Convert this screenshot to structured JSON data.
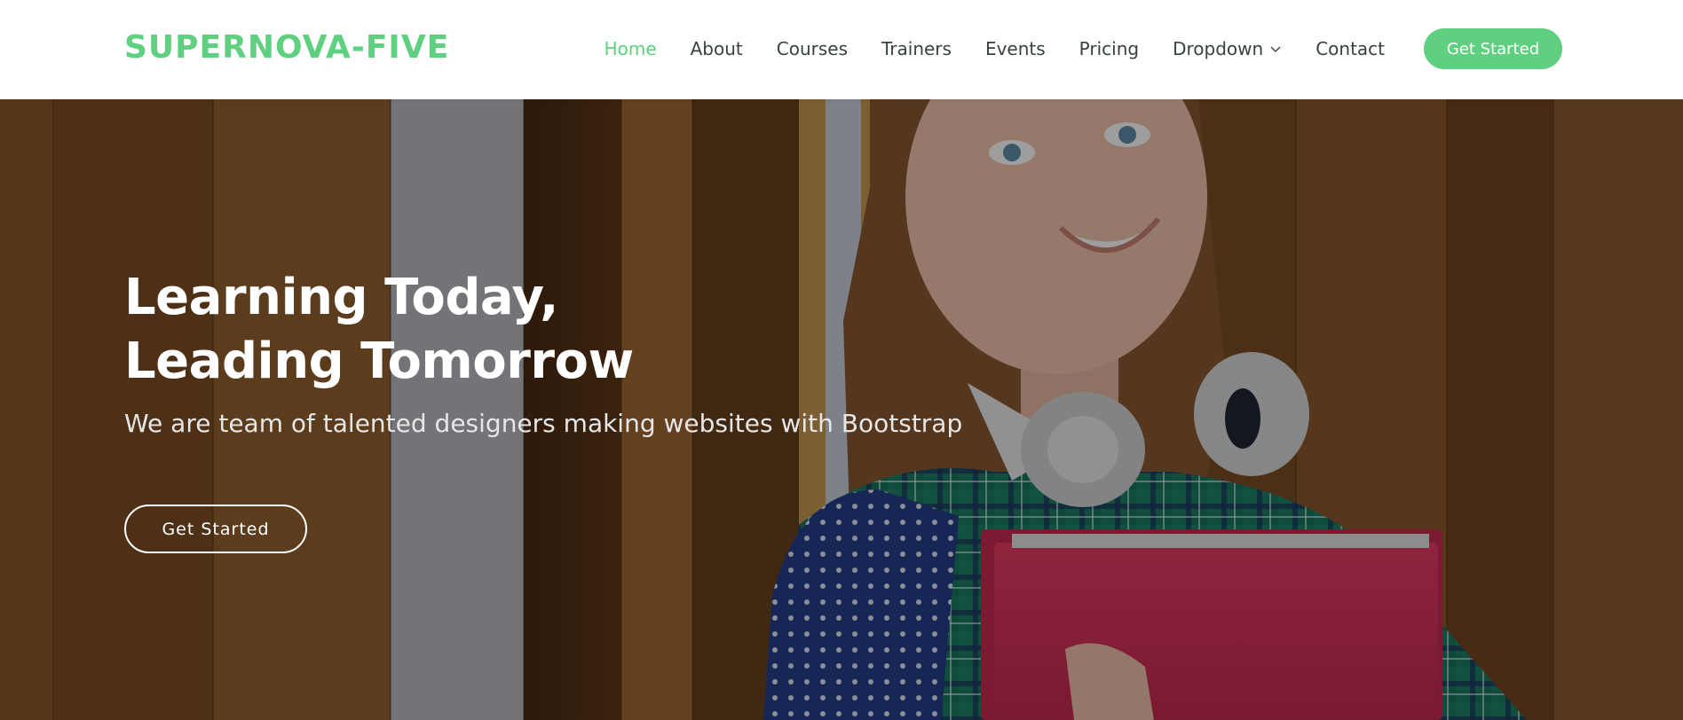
{
  "header": {
    "logo": "SUPERNOVA-FIVE",
    "nav": [
      {
        "label": "Home",
        "active": true
      },
      {
        "label": "About"
      },
      {
        "label": "Courses"
      },
      {
        "label": "Trainers"
      },
      {
        "label": "Events"
      },
      {
        "label": "Pricing"
      },
      {
        "label": "Dropdown",
        "icon": "chevron-down-icon"
      },
      {
        "label": "Contact"
      }
    ],
    "cta_label": "Get Started"
  },
  "hero": {
    "title_line1": "Learning Today,",
    "title_line2": "Leading Tomorrow",
    "subtitle": "We are team of talented designers making websites with Bootstrap",
    "cta_label": "Get Started"
  },
  "colors": {
    "accent": "#5fcf80",
    "nav_text": "#37423b",
    "hero_text": "#ffffff"
  }
}
